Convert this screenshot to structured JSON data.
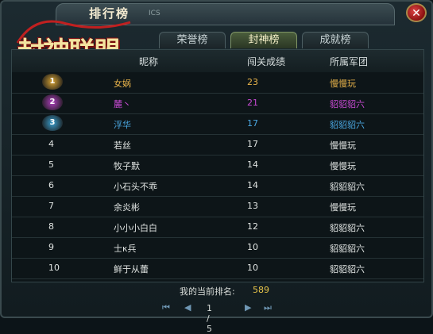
{
  "window": {
    "title": "排行榜",
    "title_en": "ICS",
    "close_icon": "close-icon",
    "logo_text": "封神联盟"
  },
  "tabs": [
    {
      "label": "荣誉榜",
      "active": false
    },
    {
      "label": "封神榜",
      "active": true
    },
    {
      "label": "成就榜",
      "active": false
    }
  ],
  "columns": {
    "nickname": "昵称",
    "score": "闯关成绩",
    "guild": "所属军团"
  },
  "rows": [
    {
      "rank": "1",
      "name": "女娲",
      "score": "23",
      "guild": "慢慢玩",
      "color": "#e8b34a"
    },
    {
      "rank": "2",
      "name": "麓丶",
      "score": "21",
      "guild": "貂貂貂六",
      "color": "#c64ad2"
    },
    {
      "rank": "3",
      "name": "浮华",
      "score": "17",
      "guild": "貂貂貂六",
      "color": "#4aa6e0"
    },
    {
      "rank": "4",
      "name": "若丝",
      "score": "17",
      "guild": "慢慢玩",
      "color": "#e0e4e2"
    },
    {
      "rank": "5",
      "name": "牧子默",
      "score": "14",
      "guild": "慢慢玩",
      "color": "#e0e4e2"
    },
    {
      "rank": "6",
      "name": "小石头不乖",
      "score": "14",
      "guild": "貂貂貂六",
      "color": "#e0e4e2"
    },
    {
      "rank": "7",
      "name": "余炎彬",
      "score": "13",
      "guild": "慢慢玩",
      "color": "#e0e4e2"
    },
    {
      "rank": "8",
      "name": "小小小白白",
      "score": "12",
      "guild": "貂貂貂六",
      "color": "#e0e4e2"
    },
    {
      "rank": "9",
      "name": "士κ兵",
      "score": "10",
      "guild": "貂貂貂六",
      "color": "#e0e4e2"
    },
    {
      "rank": "10",
      "name": "鲜于从蕾",
      "score": "10",
      "guild": "貂貂貂六",
      "color": "#e0e4e2"
    }
  ],
  "footer": {
    "my_rank_label": "我的当前排名:",
    "my_rank_value": "589"
  },
  "pager": {
    "current": "1",
    "separator": "/",
    "total": "5",
    "first_icon": "first-page-icon",
    "prev_icon": "prev-page-icon",
    "next_icon": "next-page-icon",
    "last_icon": "last-page-icon"
  }
}
